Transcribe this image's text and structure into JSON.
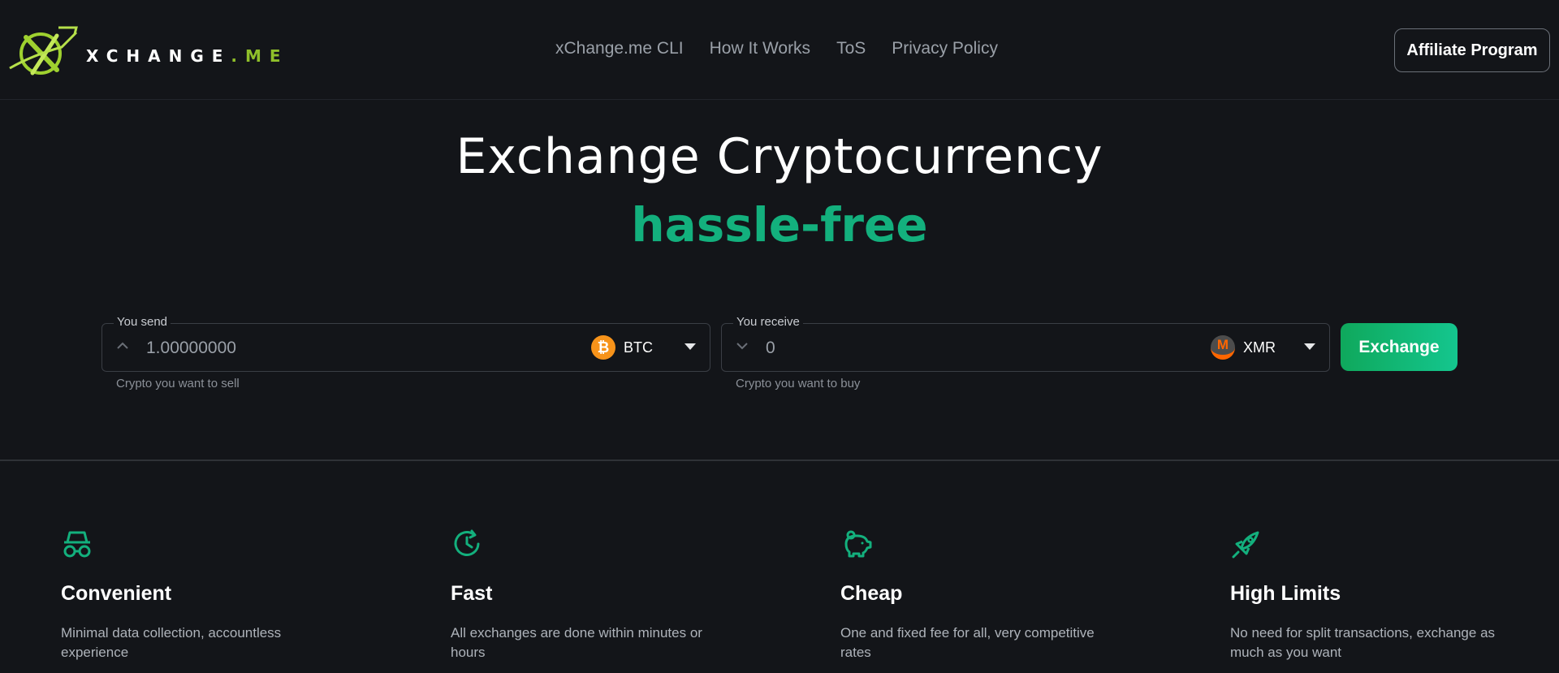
{
  "header": {
    "logo_text_a": "XCHANGE",
    "logo_text_b": ".ME",
    "nav": [
      "xChange.me CLI",
      "How It Works",
      "ToS",
      "Privacy Policy"
    ],
    "affiliate_label": "Affiliate Program"
  },
  "hero": {
    "title": "Exchange Cryptocurrency",
    "subtitle": "hassle-free"
  },
  "send": {
    "label": "You send",
    "value": "1.00000000",
    "coin": "BTC",
    "coin_glyph": "₿",
    "coin_color": "#f7931a",
    "helper": "Crypto you want to sell"
  },
  "receive": {
    "label": "You receive",
    "value": "0",
    "coin": "XMR",
    "coin_glyph": "M",
    "coin_color": "#ff6600",
    "helper": "Crypto you want to buy"
  },
  "exchange_label": "Exchange",
  "features": [
    {
      "icon": "incognito-icon",
      "title": "Convenient",
      "desc": "Minimal data collection, accountless experience"
    },
    {
      "icon": "clock-refresh-icon",
      "title": "Fast",
      "desc": "All exchanges are done within minutes or hours"
    },
    {
      "icon": "piggy-bank-icon",
      "title": "Cheap",
      "desc": "One and fixed fee for all, very competitive rates"
    },
    {
      "icon": "rocket-icon",
      "title": "High Limits",
      "desc": "No need for split transactions, exchange as much as you want"
    }
  ],
  "colors": {
    "background": "#131519",
    "accent": "#13b07d",
    "logo_green": "#8fbf2a"
  }
}
